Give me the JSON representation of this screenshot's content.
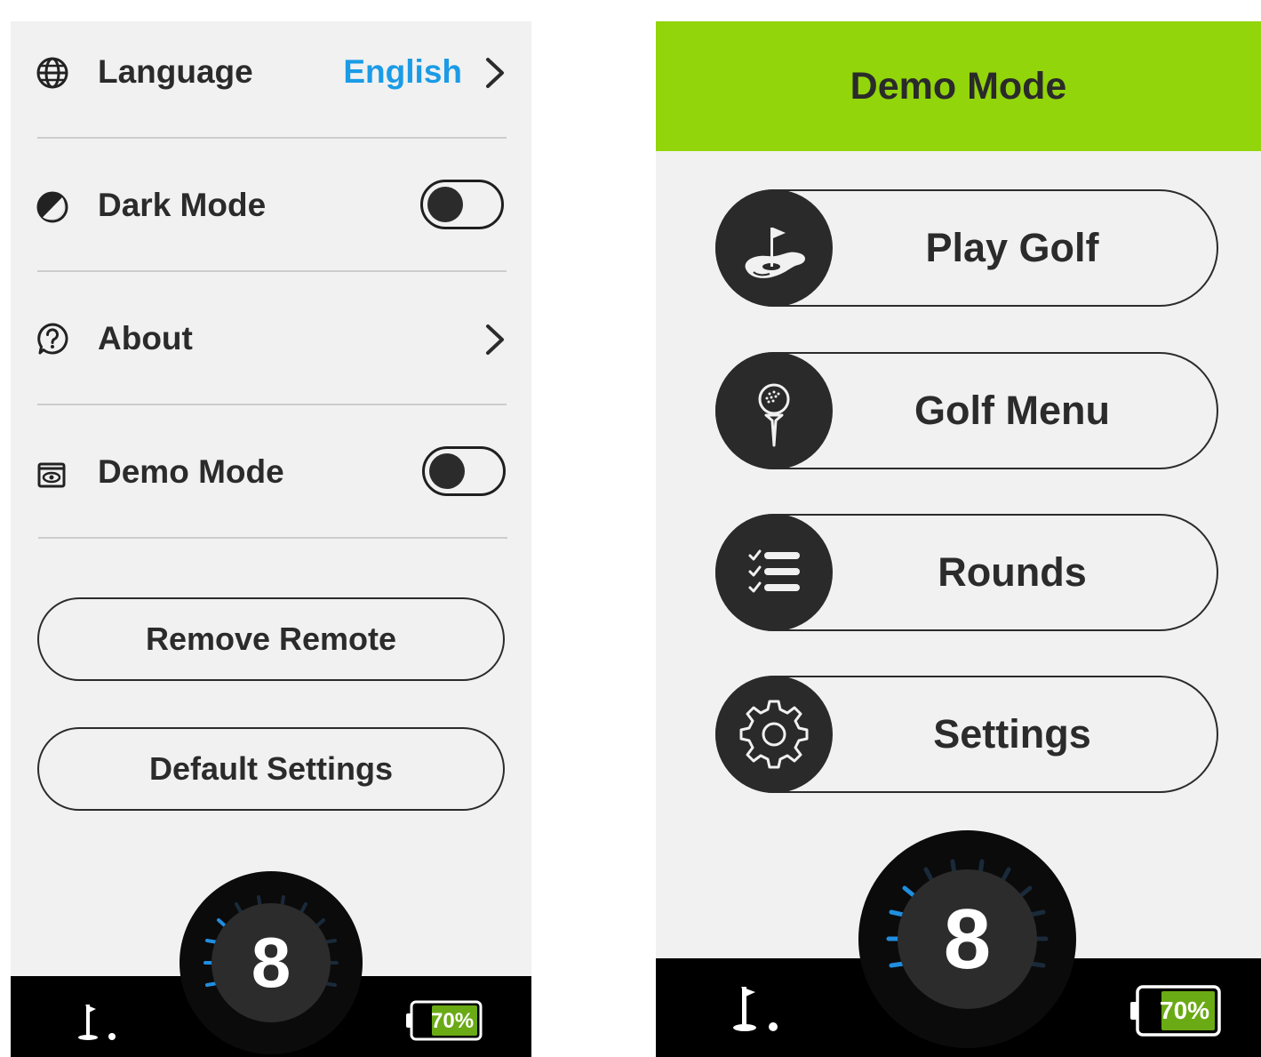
{
  "settings_screen": {
    "rows": [
      {
        "label": "Language",
        "value": "English",
        "icon": "globe-icon",
        "control": "chevron"
      },
      {
        "label": "Dark Mode",
        "icon": "contrast-icon",
        "control": "toggle",
        "state": "off"
      },
      {
        "label": "About",
        "icon": "help-circle-icon",
        "control": "chevron"
      },
      {
        "label": "Demo Mode",
        "icon": "demo-eye-icon",
        "control": "toggle",
        "state": "off"
      }
    ],
    "buttons": {
      "remove_remote": "Remove Remote",
      "default_settings": "Default Settings"
    },
    "status_bar": {
      "dial_number": "8",
      "battery_percent": "70%"
    }
  },
  "demo_screen": {
    "header_title": "Demo Mode",
    "menu": [
      {
        "label": "Play Golf",
        "icon": "golf-green-icon"
      },
      {
        "label": "Golf Menu",
        "icon": "golf-tee-icon"
      },
      {
        "label": "Rounds",
        "icon": "checklist-icon"
      },
      {
        "label": "Settings",
        "icon": "gear-icon"
      }
    ],
    "status_bar": {
      "dial_number": "8",
      "battery_percent": "70%"
    }
  },
  "colors": {
    "accent_blue": "#1a9be6",
    "header_green": "#92d50b",
    "battery_green": "#6aaa14",
    "dial_blue": "#1f8ee0",
    "background": "#f1f1f1"
  },
  "battery_level": 0.7
}
